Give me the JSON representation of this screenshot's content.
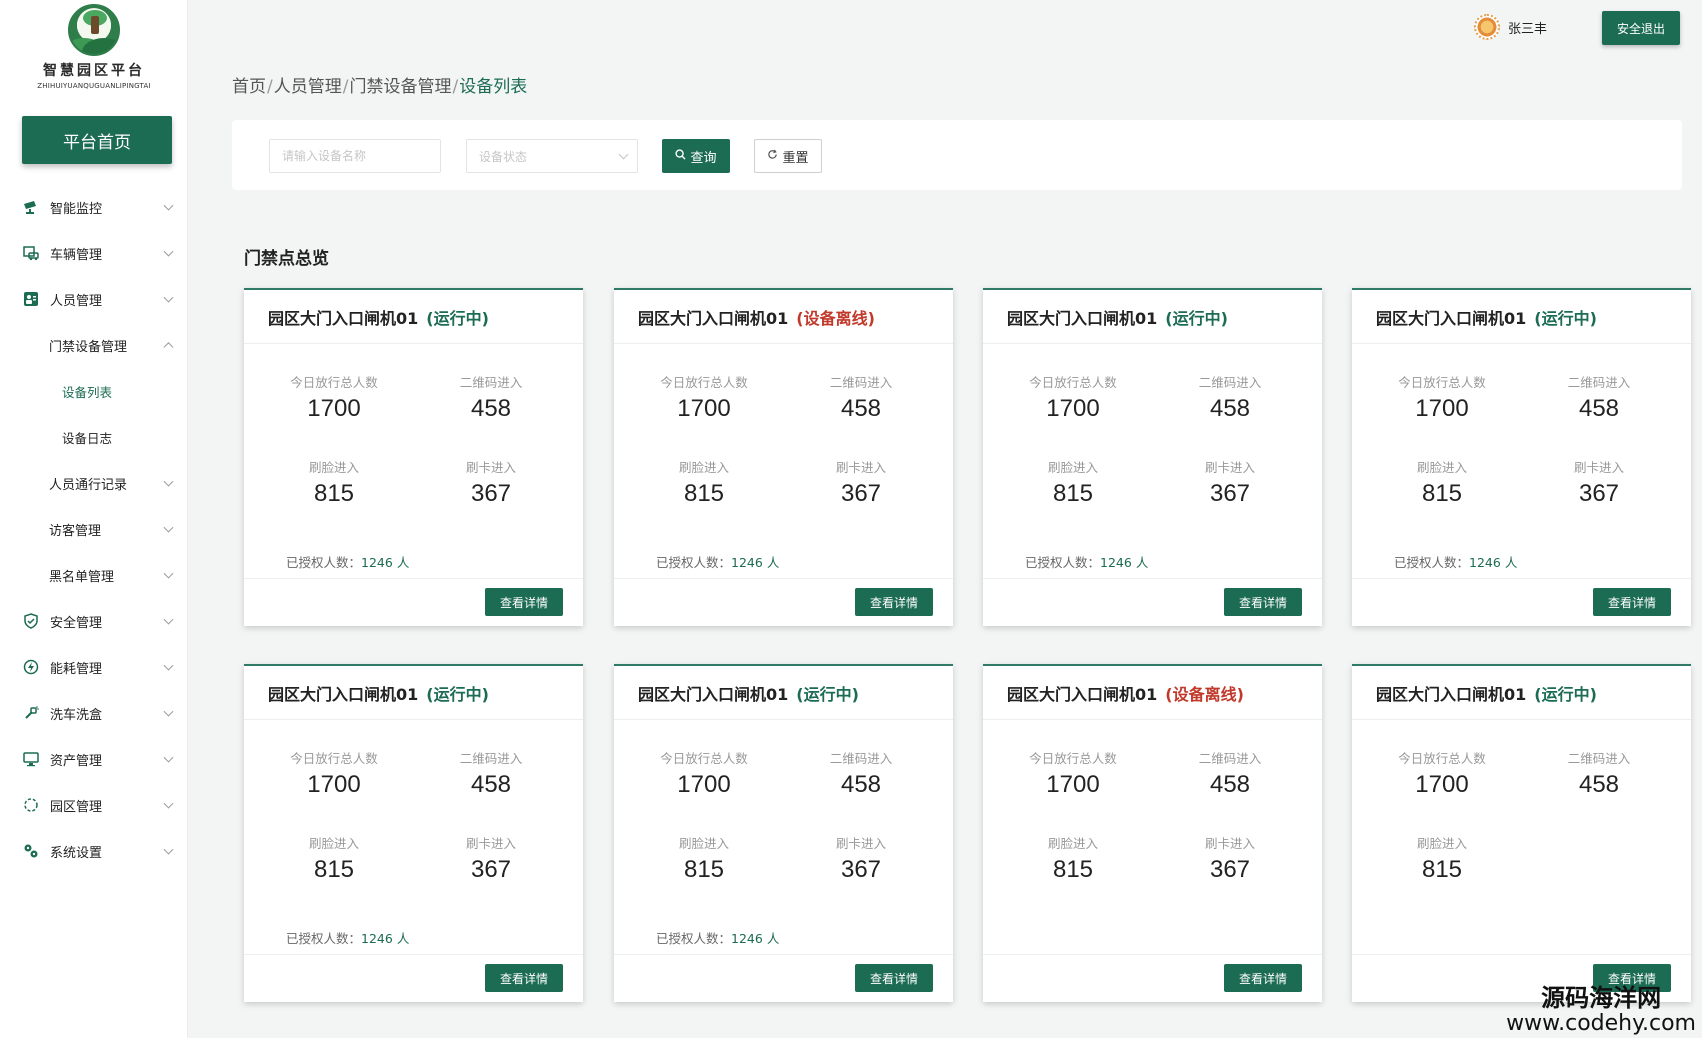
{
  "logo": {
    "title": "智慧园区平台",
    "subtitle": "ZHIHUIYUANQUGUANLIPINGTAI"
  },
  "sidebar": {
    "home_label": "平台首页",
    "items": [
      {
        "label": "智能监控",
        "icon": "camera-icon"
      },
      {
        "label": "车辆管理",
        "icon": "car-icon"
      },
      {
        "label": "人员管理",
        "icon": "person-icon"
      },
      {
        "label": "门禁设备管理"
      },
      {
        "label": "设备列表"
      },
      {
        "label": "设备日志"
      },
      {
        "label": "人员通行记录"
      },
      {
        "label": "访客管理"
      },
      {
        "label": "黑名单管理"
      },
      {
        "label": "安全管理",
        "icon": "shield-icon"
      },
      {
        "label": "能耗管理",
        "icon": "energy-icon"
      },
      {
        "label": "洗车洗盒",
        "icon": "spray-icon"
      },
      {
        "label": "资产管理",
        "icon": "monitor-icon"
      },
      {
        "label": "园区管理",
        "icon": "circle-icon"
      },
      {
        "label": "系统设置",
        "icon": "gear-icon"
      }
    ]
  },
  "header": {
    "username": "张三丰",
    "logout_label": "安全退出"
  },
  "breadcrumb": {
    "items": [
      "首页",
      "人员管理",
      "门禁设备管理"
    ],
    "current": "设备列表"
  },
  "filter": {
    "name_placeholder": "请输入设备名称",
    "status_placeholder": "设备状态",
    "query_label": "查询",
    "reset_label": "重置"
  },
  "section_title": "门禁点总览",
  "card_labels": {
    "total": "今日放行总人数",
    "qr": "二维码进入",
    "face": "刷脸进入",
    "card": "刷卡进入",
    "auth_prefix": "已授权人数：",
    "auth_unit": "人",
    "detail": "查看详情"
  },
  "cards": [
    {
      "name": "园区大门入口闸机01",
      "status": "(运行中)",
      "status_type": "run",
      "total": "1700",
      "qr": "458",
      "face": "815",
      "card": "367",
      "auth": "1246"
    },
    {
      "name": "园区大门入口闸机01",
      "status": "(设备离线)",
      "status_type": "off",
      "total": "1700",
      "qr": "458",
      "face": "815",
      "card": "367",
      "auth": "1246"
    },
    {
      "name": "园区大门入口闸机01",
      "status": "(运行中)",
      "status_type": "run",
      "total": "1700",
      "qr": "458",
      "face": "815",
      "card": "367",
      "auth": "1246"
    },
    {
      "name": "园区大门入口闸机01",
      "status": "(运行中)",
      "status_type": "run",
      "total": "1700",
      "qr": "458",
      "face": "815",
      "card": "367",
      "auth": "1246"
    },
    {
      "name": "园区大门入口闸机01",
      "status": "(运行中)",
      "status_type": "run",
      "total": "1700",
      "qr": "458",
      "face": "815",
      "card": "367",
      "auth": "1246"
    },
    {
      "name": "园区大门入口闸机01",
      "status": "(运行中)",
      "status_type": "run",
      "total": "1700",
      "qr": "458",
      "face": "815",
      "card": "367",
      "auth": "1246"
    },
    {
      "name": "园区大门入口闸机01",
      "status": "(设备离线)",
      "status_type": "off",
      "total": "1700",
      "qr": "458",
      "face": "815",
      "card": "367",
      "auth": ""
    },
    {
      "name": "园区大门入口闸机01",
      "status": "(运行中)",
      "status_type": "run",
      "total": "1700",
      "qr": "458",
      "face": "815",
      "card": "",
      "auth": ""
    }
  ],
  "watermark": {
    "line1": "源码海洋网",
    "line2": "www.codehy.com"
  },
  "colors": {
    "primary": "#1c6b53",
    "offline": "#c0392b",
    "background": "#f3f5f5"
  }
}
